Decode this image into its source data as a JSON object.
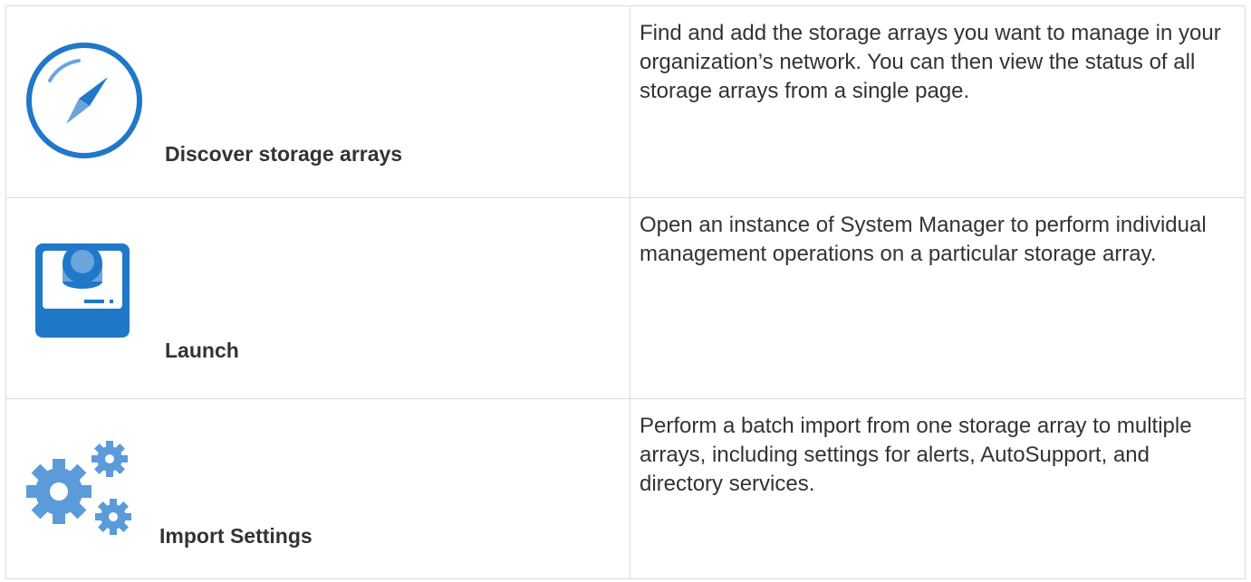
{
  "rows": [
    {
      "icon": "compass-icon",
      "title": "Discover storage arrays",
      "description": "Find and add the storage arrays you want to manage in your organization’s network. You can then view the status of all storage arrays from a single page."
    },
    {
      "icon": "storage-device-icon",
      "title": "Launch",
      "description": "Open an instance of System Manager to perform individual management operations on a particular storage array."
    },
    {
      "icon": "gears-icon",
      "title": "Import Settings",
      "description": "Perform a batch import from one storage array to multiple arrays, including settings for alerts, AutoSupport, and directory services."
    }
  ],
  "colors": {
    "accent_blue": "#1f78c8",
    "accent_light_blue": "#6aa5de",
    "gear_blue": "#5b9bd9",
    "border": "#dcdcdc",
    "text": "#333333"
  }
}
